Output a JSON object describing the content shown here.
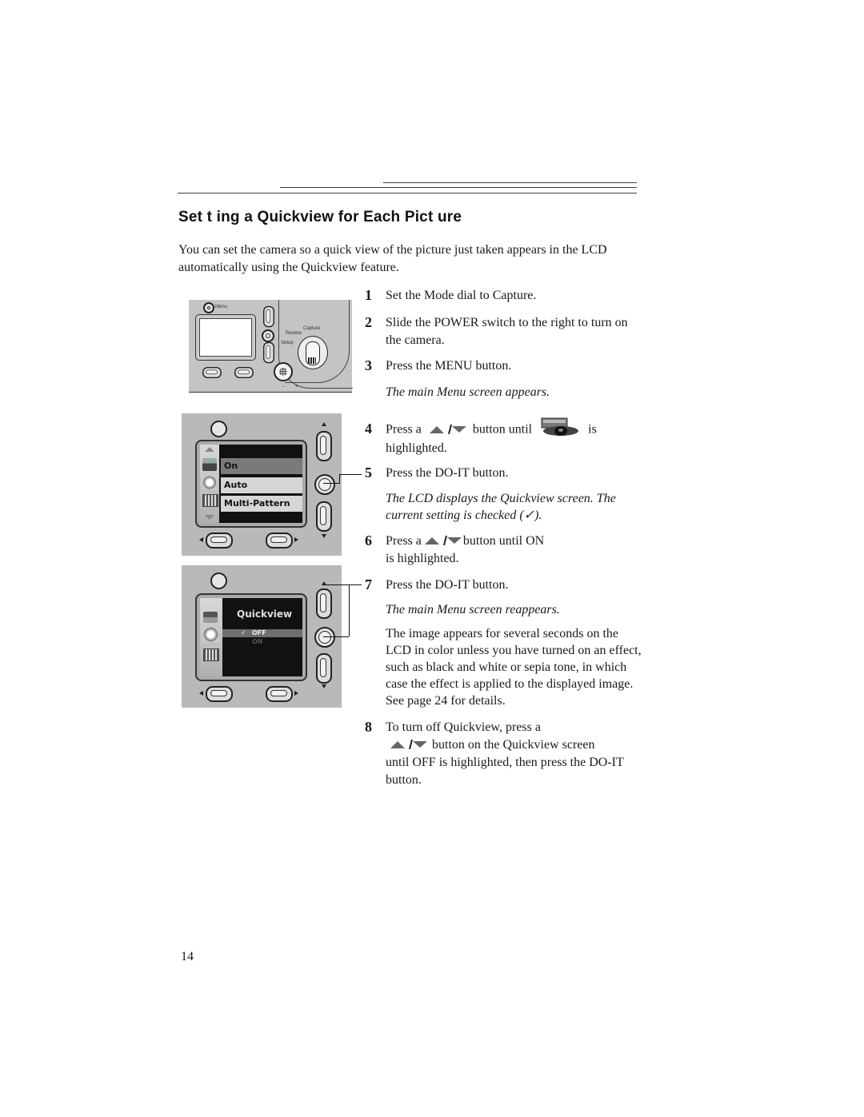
{
  "page": {
    "title": "Set t ing a Quickview for Each Pict ure",
    "intro": "You can set the camera so a quick view of the picture just taken appears in the LCD automatically using the Quickview feature.",
    "page_number": "14"
  },
  "steps": [
    {
      "num": "1",
      "text": "Set the Mode dial to Capture."
    },
    {
      "num": "2",
      "text": "Slide the POWER switch to the right to turn on the camera."
    },
    {
      "num": "3",
      "text": "Press the MENU button."
    },
    {
      "num": "4",
      "pre": "Press a",
      "mid": "button until",
      "post": "is",
      "cont": "highlighted."
    },
    {
      "num": "5",
      "text": "Press the DO-IT button."
    },
    {
      "num": "6",
      "pre": "Press a",
      "mid": "button until ON",
      "cont": "is highlighted."
    },
    {
      "num": "7",
      "text": "Press the DO-IT button."
    },
    {
      "num": "8",
      "text": "To turn off Quickview, press a",
      "mid": "button on the Quickview screen",
      "cont": "until OFF is highlighted, then press the DO-IT button."
    }
  ],
  "notes": {
    "after_3": "The main Menu screen appears.",
    "after_5": "The LCD displays the Quickview screen. The current setting is checked (✓).",
    "after_7_italic": "The main Menu screen reappears.",
    "after_7_body": "The image appears for several seconds on the LCD in color unless you have turned on an effect, such as black and white or sepia tone, in which case the effect is applied to the displayed image. See page 24 for details."
  },
  "figure1": {
    "menu_label": "Menu",
    "dial_labels": [
      "Capture",
      "Review",
      "Setup"
    ],
    "minus": "−",
    "plus": "+"
  },
  "figure2": {
    "menu_items": [
      "On",
      "Auto",
      "Multi-Pattern"
    ],
    "highlighted_index": 0
  },
  "figure3": {
    "screen_title": "Quickview",
    "options": [
      "OFF",
      "ON"
    ],
    "checked": "✓",
    "checked_option": "OFF"
  },
  "icons": {
    "up_down": "up-down-arrows-icon",
    "quickview": "quickview-eye-icon"
  }
}
